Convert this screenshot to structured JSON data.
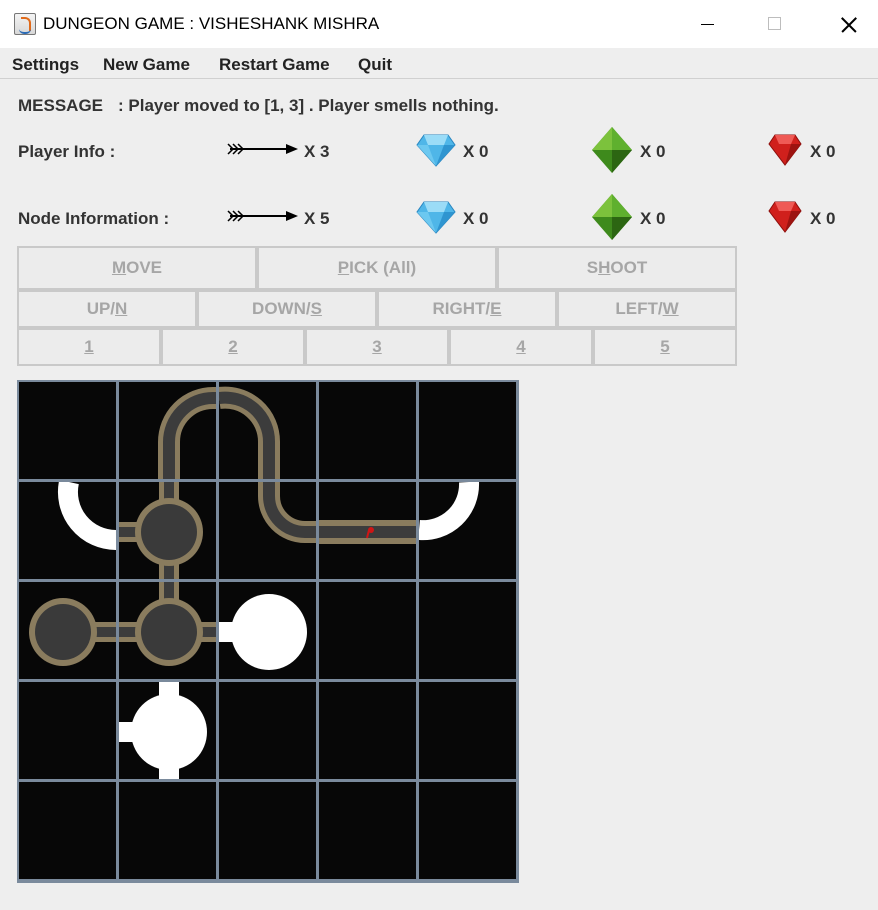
{
  "window": {
    "title": "DUNGEON GAME : VISHESHANK MISHRA"
  },
  "menu": [
    "Settings",
    "New Game",
    "Restart Game",
    "Quit"
  ],
  "message": {
    "label": "MESSAGE",
    "text": ": Player moved to [1, 3] .  Player smells nothing."
  },
  "player_info": {
    "label": "Player Info :",
    "arrows": "X 3",
    "diamonds": "X 0",
    "emeralds": "X 0",
    "rubies": "X 0"
  },
  "node_info": {
    "label": "Node Information :",
    "arrows": "X 5",
    "diamonds": "X 0",
    "emeralds": "X 0",
    "rubies": "X 0"
  },
  "actions": [
    {
      "pre": "",
      "key": "M",
      "post": "OVE"
    },
    {
      "pre": "",
      "key": "P",
      "post": "ICK (All)"
    },
    {
      "pre": "S",
      "key": "H",
      "post": "OOT"
    }
  ],
  "directions": [
    {
      "pre": "UP/",
      "key": "N",
      "post": ""
    },
    {
      "pre": "DOWN/",
      "key": "S",
      "post": ""
    },
    {
      "pre": "RIGHT/",
      "key": "E",
      "post": ""
    },
    {
      "pre": "LEFT/",
      "key": "W",
      "post": ""
    }
  ],
  "distances": [
    "1",
    "2",
    "3",
    "4",
    "5"
  ],
  "colors": {
    "background": "#eeeeee",
    "tile": "#070707",
    "path_border": "#8a7c5e",
    "path_floor": "#3c3c3c",
    "unexplored": "#ffffff",
    "diamond": "#4fb6e8",
    "emerald": "#3e8a1c",
    "ruby": "#d0201c",
    "player_marker": "#d01515"
  }
}
